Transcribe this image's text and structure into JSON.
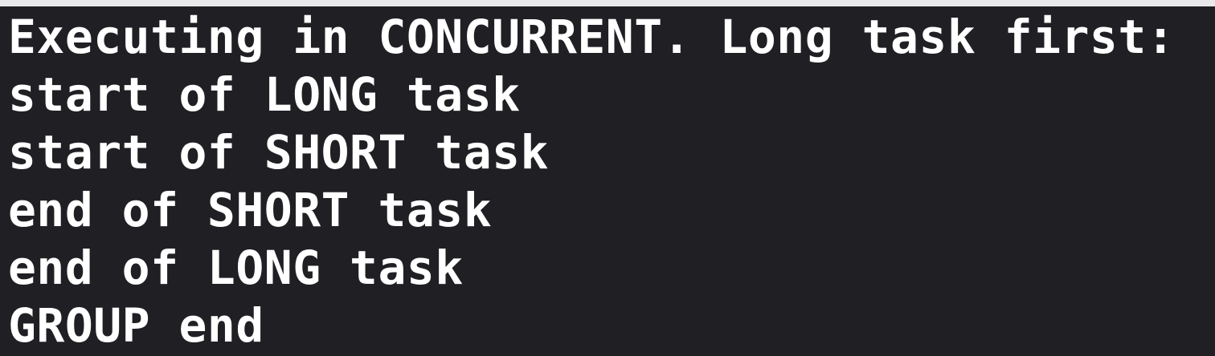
{
  "console": {
    "lines": [
      "Executing in CONCURRENT. Long task first:",
      "start of LONG task",
      "start of SHORT task",
      "end of SHORT task",
      "end of LONG task",
      "GROUP end"
    ]
  }
}
